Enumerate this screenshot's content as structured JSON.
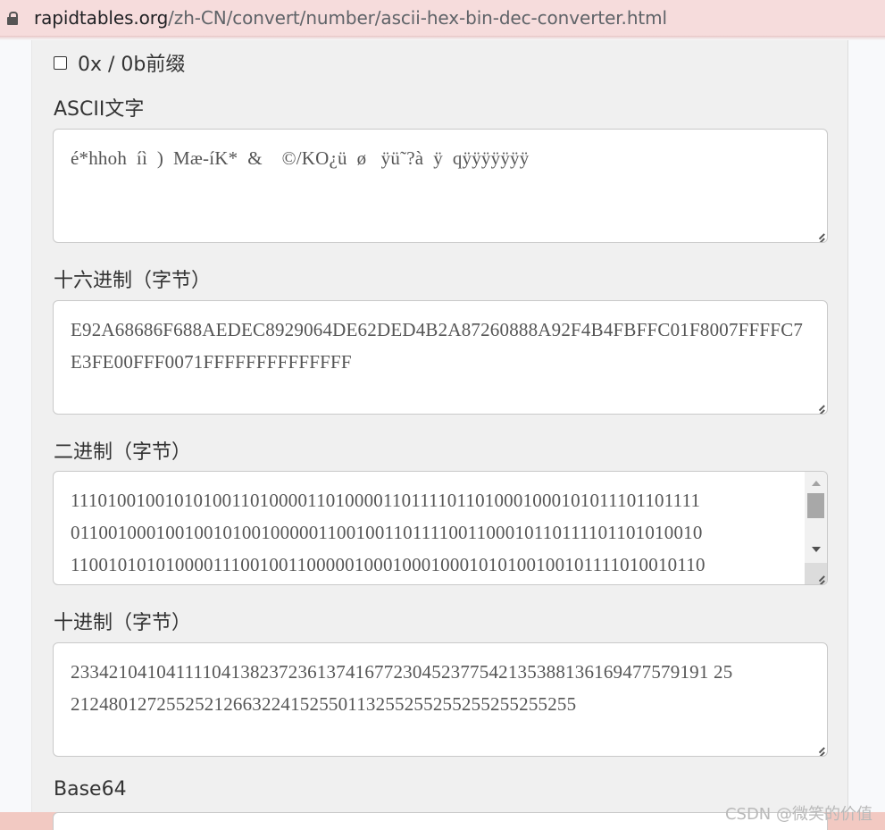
{
  "browser": {
    "url_domain": "rapidtables.org",
    "url_path": "/zh-CN/convert/number/ascii-hex-bin-dec-converter.html"
  },
  "options": {
    "prefix_label": "0x / 0b前缀",
    "prefix_checked": false
  },
  "fields": {
    "ascii": {
      "label": "ASCII文字",
      "value": "é*hhoh  íì  )  Mæ-íK*  &    ©/KO¿ü  ø   ÿü˜?à  ÿ  qÿÿÿÿÿÿÿ"
    },
    "hex": {
      "label": "十六进制（字节）",
      "lines": [
        "E92A68686F688AEDEC8929064DE62DED4B2A87260888A92F4B4FBFFC01F8007FFFFC7",
        "E3FE00FFF0071FFFFFFFFFFFFFF"
      ]
    },
    "binary": {
      "label": "二进制（字节）",
      "lines": [
        "1110100100101010011010000110100001101111011010001000101011101101111",
        "0110010001001001010010000011001001101111001100010110111101101010010",
        "1100101010100001110010011000001000100010001010100100101111010010110"
      ]
    },
    "decimal": {
      "label": "十进制（字节）",
      "lines": [
        "2334210410411110413823723613741677230452377542135388136169477579191 25",
        "21248012725525212663224152550113255255255255255255255"
      ]
    },
    "base64": {
      "label": "Base64"
    }
  },
  "watermark": "CSDN @微笑的价值"
}
